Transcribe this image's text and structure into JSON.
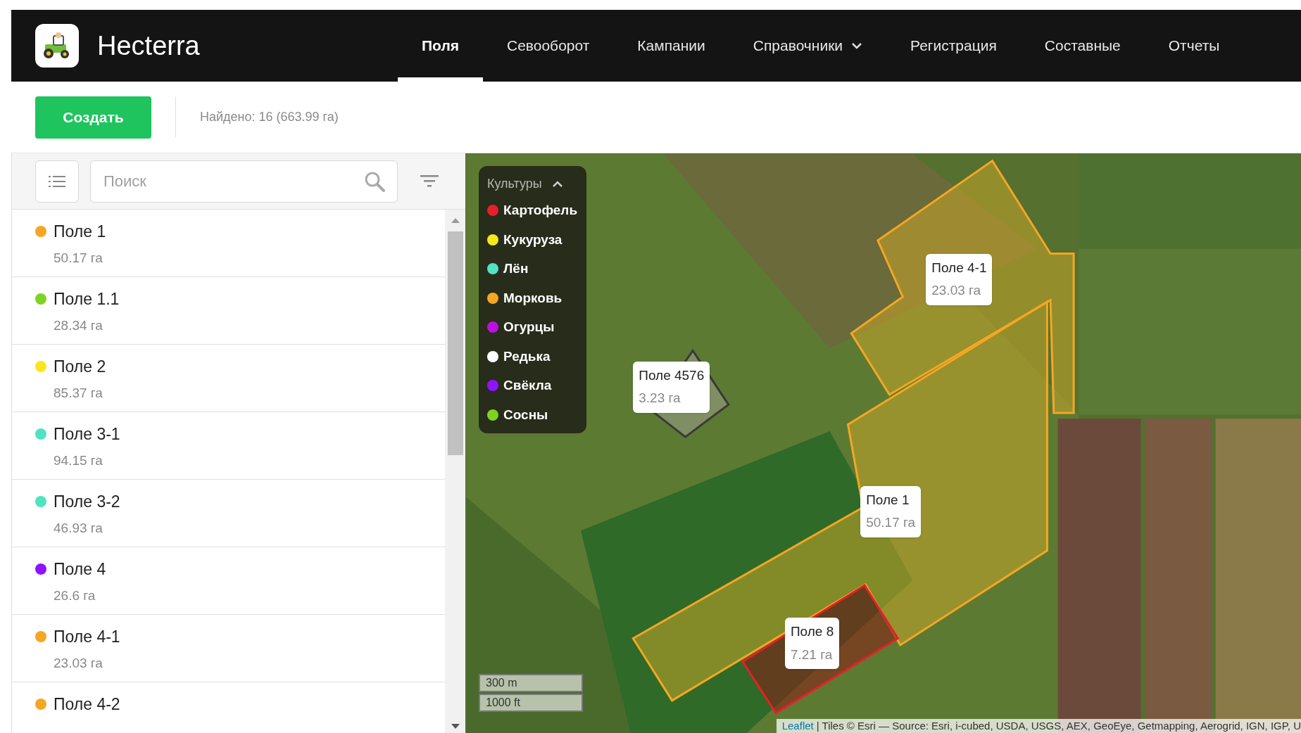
{
  "header": {
    "app_name": "Hecterra",
    "nav": [
      {
        "label": "Поля",
        "selected": true,
        "kind": "link"
      },
      {
        "label": "Севооборот",
        "selected": false,
        "kind": "link"
      },
      {
        "label": "Кампании",
        "selected": false,
        "kind": "link"
      },
      {
        "label": "Справочники",
        "selected": false,
        "kind": "dropdown"
      },
      {
        "label": "Регистрация",
        "selected": false,
        "kind": "link"
      },
      {
        "label": "Составные",
        "selected": false,
        "kind": "link"
      },
      {
        "label": "Отчеты",
        "selected": false,
        "kind": "link"
      }
    ]
  },
  "toolbar": {
    "create_button": "Создать",
    "found": "Найдено: 16 (663.99 га)"
  },
  "sidebar": {
    "search": {
      "placeholder": "Поиск"
    },
    "fields": [
      {
        "name": "Поле 1",
        "area": "50.17 га",
        "color": "#f5a623"
      },
      {
        "name": "Поле 1.1",
        "area": "28.34 га",
        "color": "#7ed321"
      },
      {
        "name": "Поле 2",
        "area": "85.37 га",
        "color": "#f8e71c"
      },
      {
        "name": "Поле 3-1",
        "area": "94.15 га",
        "color": "#50e3c2"
      },
      {
        "name": "Поле 3-2",
        "area": "46.93 га",
        "color": "#50e3c2"
      },
      {
        "name": "Поле 4",
        "area": "26.6 га",
        "color": "#9013fe"
      },
      {
        "name": "Поле 4-1",
        "area": "23.03 га",
        "color": "#f5a623"
      },
      {
        "name": "Поле 4-2",
        "color": "#f5a623"
      }
    ]
  },
  "map": {
    "legend": {
      "title": "Культуры",
      "expanded": true,
      "items": [
        {
          "label": "Картофель",
          "color": "#e5202a"
        },
        {
          "label": "Кукуруза",
          "color": "#f8e71c"
        },
        {
          "label": "Лён",
          "color": "#50e3c2"
        },
        {
          "label": "Морковь",
          "color": "#f5a623"
        },
        {
          "label": "Огурцы",
          "color": "#bd10e0"
        },
        {
          "label": "Редька",
          "color": "#ffffff"
        },
        {
          "label": "Свёкла",
          "color": "#9013fe"
        },
        {
          "label": "Сосны",
          "color": "#7ed321"
        }
      ]
    },
    "fields": [
      {
        "name": "Поле 4-1",
        "area": "23.03 га",
        "color": "#f5a623"
      },
      {
        "name": "Поле 4576",
        "area": "3.23 га",
        "color": "#3a3a3a"
      },
      {
        "name": "Поле 1",
        "area": "50.17 га",
        "color": "#f5a623"
      },
      {
        "name": "Поле 8",
        "area": "7.21 га",
        "color": "#e5202a"
      }
    ],
    "scale": [
      "300 m",
      "1000 ft"
    ],
    "attribution": {
      "link": "Leaflet",
      "text": "| Tiles © Esri — Source: Esri, i-cubed, USDA, USGS, AEX, GeoEye, Getmapping, Aerogrid, IGN, IGP, U"
    }
  }
}
